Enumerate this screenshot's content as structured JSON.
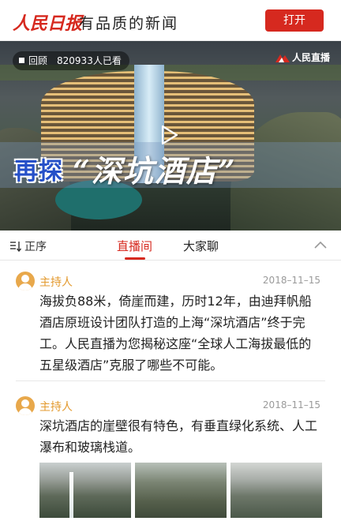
{
  "header": {
    "logo_text": "人民日报",
    "slogan": "有品质的新闻",
    "open_button": "打开"
  },
  "video": {
    "replay_label": "回顾",
    "view_count": "820933人已看",
    "broadcaster_logo": "人民直播",
    "title_part_a": "再探",
    "title_part_b": "“深坑酒店”"
  },
  "tabs": {
    "sort_label": "正序",
    "items": [
      "直播间",
      "大家聊"
    ],
    "active": "直播间"
  },
  "feed": {
    "posts": [
      {
        "author": "主持人",
        "date": "2018–11–15",
        "text": "海拔负88米，倚崖而建，历时12年，由迪拜帆船酒店原班设计团队打造的上海“深坑酒店”终于完工。人民直播为您揭秘这座“全球人工海拔最低的五星级酒店”克服了哪些不可能。"
      },
      {
        "author": "主持人",
        "date": "2018–11–15",
        "text": "深坑酒店的崖壁很有特色，有垂直绿化系统、人工瀑布和玻璃栈道。"
      }
    ]
  },
  "colors": {
    "brand_red": "#d6291f",
    "author_orange": "#e39a2f"
  }
}
